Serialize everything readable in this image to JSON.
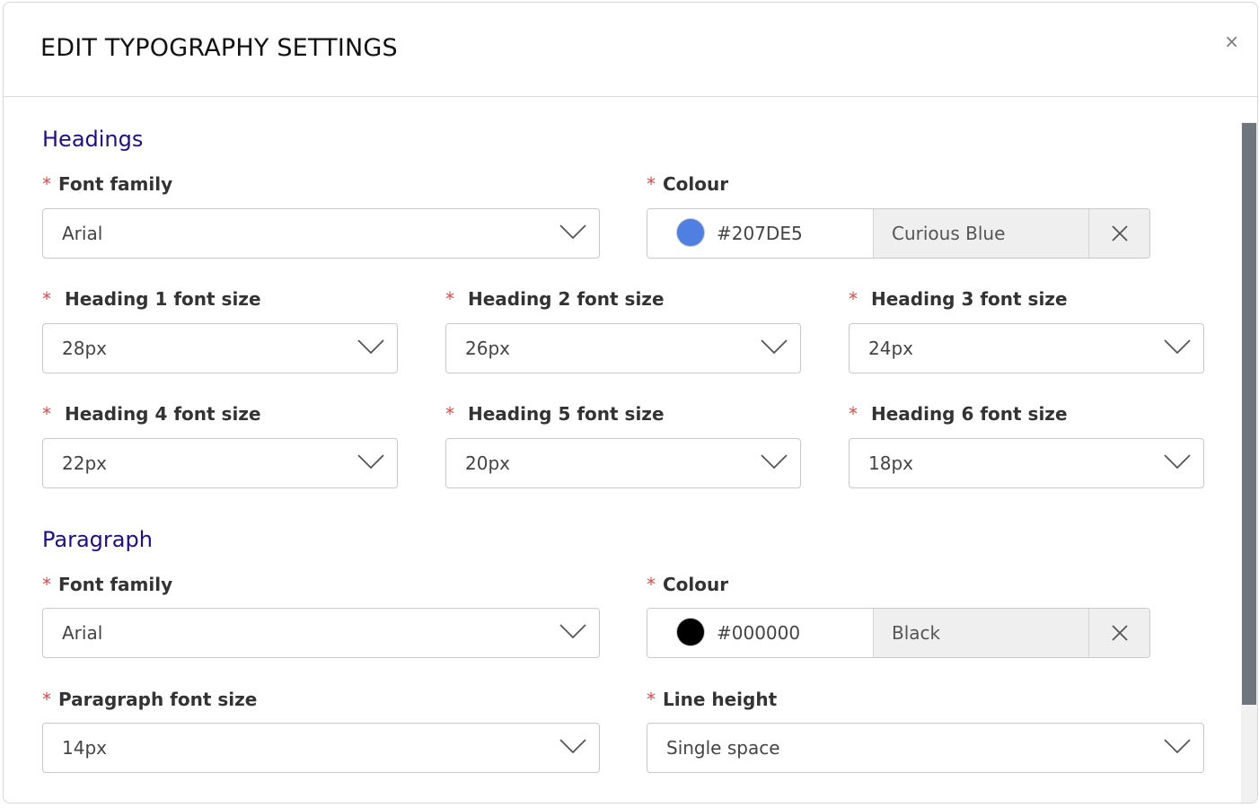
{
  "modal": {
    "title": "EDIT TYPOGRAPHY SETTINGS",
    "close_symbol": "×"
  },
  "required_mark": "*",
  "headings": {
    "title": "Headings",
    "font_family": {
      "label": "Font family",
      "value": "Arial"
    },
    "colour": {
      "label": "Colour",
      "hex": "#207DE5",
      "name": "Curious Blue",
      "swatch_color": "#4f7fe0"
    },
    "sizes": [
      {
        "label": "Heading 1 font size",
        "value": "28px"
      },
      {
        "label": "Heading 2 font size",
        "value": "26px"
      },
      {
        "label": "Heading 3 font size",
        "value": "24px"
      },
      {
        "label": "Heading 4 font size",
        "value": "22px"
      },
      {
        "label": "Heading 5 font size",
        "value": "20px"
      },
      {
        "label": "Heading 6 font size",
        "value": "18px"
      }
    ]
  },
  "paragraph": {
    "title": "Paragraph",
    "font_family": {
      "label": "Font family",
      "value": "Arial"
    },
    "colour": {
      "label": "Colour",
      "hex": "#000000",
      "name": "Black",
      "swatch_color": "#000000"
    },
    "font_size": {
      "label": "Paragraph font size",
      "value": "14px"
    },
    "line_height": {
      "label": "Line height",
      "value": "Single space"
    }
  },
  "icons": {
    "dropdown": "chevron-down-icon",
    "clear": "close-icon"
  },
  "colors": {
    "section_title": "#1f0d8f",
    "required": "#d94b4b",
    "scroll_thumb": "#6f757c"
  }
}
